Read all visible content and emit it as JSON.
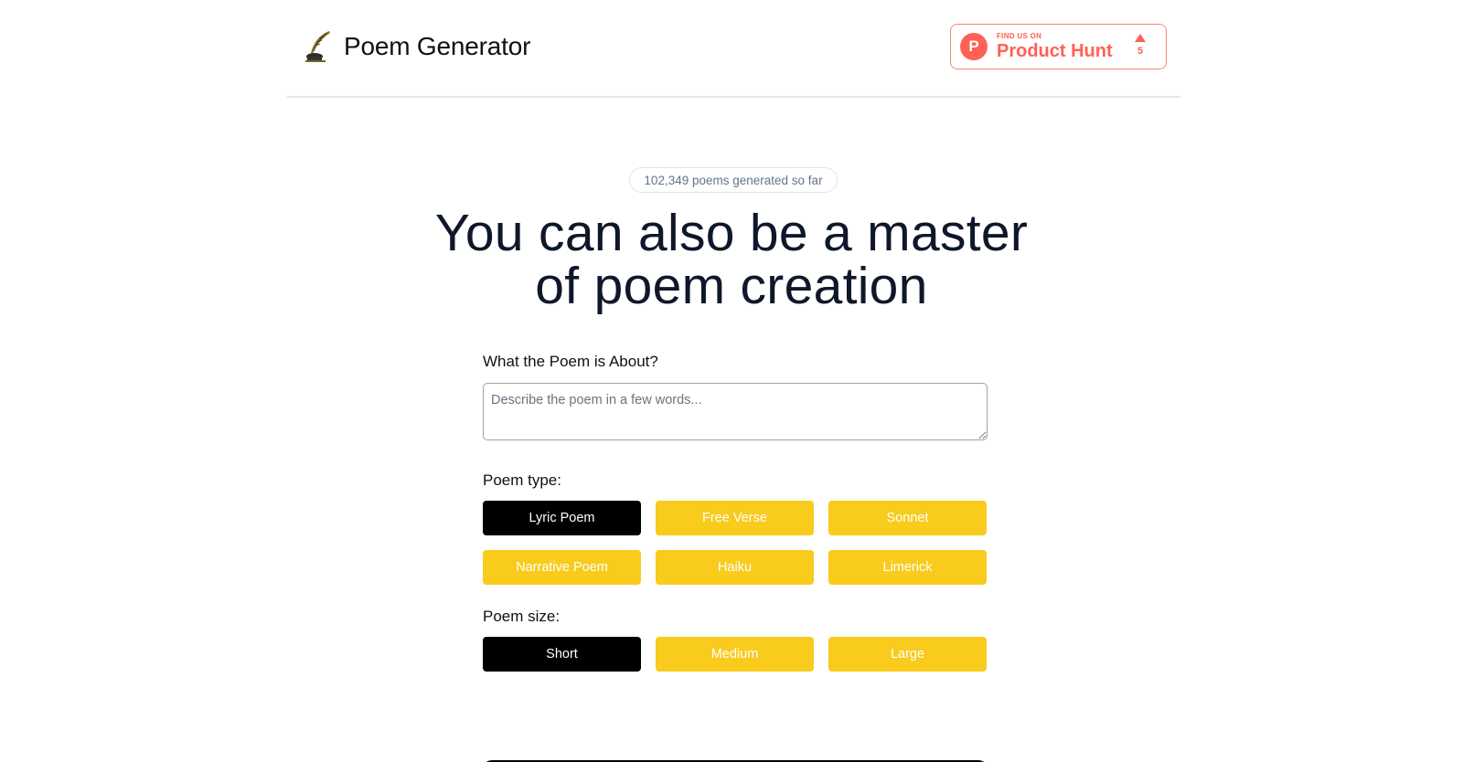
{
  "header": {
    "brand_name": "Poem Generator",
    "logo_icon": "quill-ink-icon",
    "product_hunt": {
      "small_text": "FIND US ON",
      "big_text": "Product Hunt",
      "letter": "P",
      "votes": "5",
      "color": "#ff6154"
    }
  },
  "hero": {
    "counter_text": "102,349 poems generated so far",
    "headline_line1": "You can also be a master",
    "headline_line2": "of poem creation"
  },
  "form": {
    "about_label": "What the Poem is About?",
    "about_placeholder": "Describe the poem in a few words...",
    "type_label": "Poem type:",
    "types": [
      {
        "label": "Lyric Poem",
        "selected": true
      },
      {
        "label": "Free Verse",
        "selected": false
      },
      {
        "label": "Sonnet",
        "selected": false
      },
      {
        "label": "Narrative Poem",
        "selected": false
      },
      {
        "label": "Haiku",
        "selected": false
      },
      {
        "label": "Limerick",
        "selected": false
      }
    ],
    "size_label": "Poem size:",
    "sizes": [
      {
        "label": "Short",
        "selected": true
      },
      {
        "label": "Medium",
        "selected": false
      },
      {
        "label": "Large",
        "selected": false
      }
    ]
  },
  "colors": {
    "accent_yellow": "#f8cb1d",
    "selected_black": "#000000",
    "text_dark": "#0f172a"
  }
}
